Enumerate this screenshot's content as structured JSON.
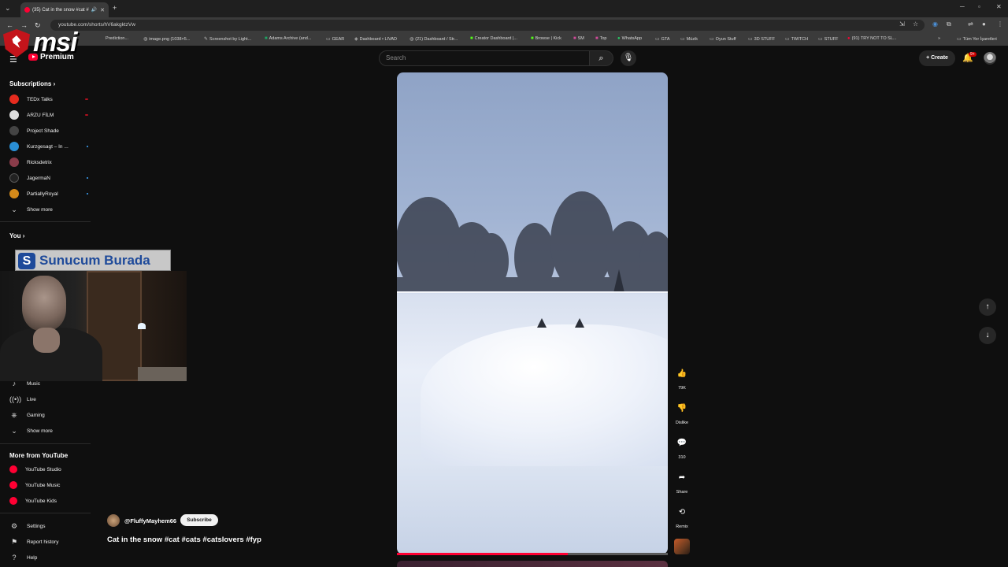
{
  "browser": {
    "tab_title": "(35) Cat in the snow #cat #",
    "url": "youtube.com/shorts/hV6akgktzVw",
    "bookmarks": [
      {
        "label": "Prediction...",
        "icon": "page-icon"
      },
      {
        "label": "image.png (1038×5...",
        "icon": "globe-icon"
      },
      {
        "label": "Screenshot by Light...",
        "icon": "feather-icon"
      },
      {
        "label": "Adams Archive (and...",
        "icon": "sheet-icon"
      },
      {
        "label": "GEAR",
        "icon": "folder-icon"
      },
      {
        "label": "Dashboard • LIVAD",
        "icon": "dashboard-icon"
      },
      {
        "label": "(21) Dashboard / Str...",
        "icon": "globe-icon"
      },
      {
        "label": "Creator Dashboard |...",
        "icon": "kick-icon"
      },
      {
        "label": "Browse | Kick",
        "icon": "kick-icon"
      },
      {
        "label": "SM",
        "icon": "bookmark-icon"
      },
      {
        "label": "Top",
        "icon": "bookmark-icon"
      },
      {
        "label": "WhatsApp",
        "icon": "whatsapp-icon"
      },
      {
        "label": "GTA",
        "icon": "folder-icon"
      },
      {
        "label": "Müzik",
        "icon": "folder-icon"
      },
      {
        "label": "Oyun Stuff",
        "icon": "folder-icon"
      },
      {
        "label": "3D STUFF",
        "icon": "folder-icon"
      },
      {
        "label": "TWITCH",
        "icon": "folder-icon"
      },
      {
        "label": "STUFF",
        "icon": "folder-icon"
      },
      {
        "label": "(91) TRY NOT TO SL...",
        "icon": "youtube-icon"
      }
    ],
    "all_bookmarks": "Tüm Yer İşaretleri"
  },
  "overlay": {
    "brand": "msi",
    "sunucum": "Sunucum Burada"
  },
  "masthead": {
    "logo_label": "Premium",
    "search_placeholder": "Search",
    "create_label": "Create",
    "notif_badge": "9+"
  },
  "sidebar": {
    "subscriptions_label": "Subscriptions",
    "subscriptions": [
      {
        "name": "TEDx Talks",
        "avatar_color": "#e62b1e",
        "indicator": "live"
      },
      {
        "name": "ARZU FİLM",
        "avatar_color": "#dcdcdc",
        "indicator": "live"
      },
      {
        "name": "Project Shade",
        "avatar_color": "#444444",
        "indicator": "none"
      },
      {
        "name": "Kurzgesagt – In ...",
        "avatar_color": "#2a8fd6",
        "indicator": "new"
      },
      {
        "name": "Ricksdetrix",
        "avatar_color": "#8a3c4a",
        "indicator": "none"
      },
      {
        "name": "JagermaN",
        "avatar_color": "#222222",
        "indicator": "new"
      },
      {
        "name": "PartiallyRoyal",
        "avatar_color": "#d48a1a",
        "indicator": "new"
      }
    ],
    "show_more_1": "Show more",
    "you_label": "You",
    "explore_items": [
      {
        "label": "Music",
        "icon": "music-icon"
      },
      {
        "label": "Live",
        "icon": "live-icon"
      },
      {
        "label": "Gaming",
        "icon": "gaming-icon"
      }
    ],
    "show_more_2": "Show more",
    "more_from_label": "More from YouTube",
    "more_from": [
      {
        "label": "YouTube Studio"
      },
      {
        "label": "YouTube Music"
      },
      {
        "label": "YouTube Kids"
      }
    ],
    "footer": [
      {
        "label": "Settings",
        "icon": "gear-icon"
      },
      {
        "label": "Report history",
        "icon": "flag-icon"
      },
      {
        "label": "Help",
        "icon": "help-icon"
      }
    ]
  },
  "short": {
    "channel": "@FluffyMayhem66",
    "subscribe_label": "Subscribe",
    "title": "Cat in the snow #cat #cats #catslovers #fyp",
    "progress": 0.63,
    "actions": {
      "likes": "79K",
      "dislike": "Dislike",
      "comments": "310",
      "share": "Share",
      "remix": "Remix"
    }
  },
  "colors": {
    "accent": "#ff0033",
    "background": "#0f0f0f"
  }
}
